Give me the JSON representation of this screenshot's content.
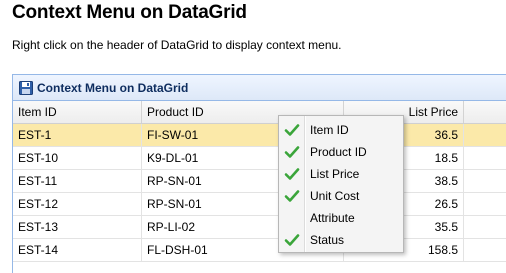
{
  "page": {
    "title": "Context Menu on DataGrid",
    "description": "Right click on the header of DataGrid to display context menu."
  },
  "grid": {
    "panel_title": "Context Menu on DataGrid",
    "panel_icon": "save-icon",
    "columns": [
      "Item ID",
      "Product ID",
      "List Price",
      ""
    ],
    "rows": [
      [
        "EST-1",
        "FI-SW-01",
        "36.5",
        ""
      ],
      [
        "EST-10",
        "K9-DL-01",
        "18.5",
        ""
      ],
      [
        "EST-11",
        "RP-SN-01",
        "38.5",
        ""
      ],
      [
        "EST-12",
        "RP-SN-01",
        "26.5",
        ""
      ],
      [
        "EST-13",
        "RP-LI-02",
        "35.5",
        ""
      ],
      [
        "EST-14",
        "FL-DSH-01",
        "158.5",
        ""
      ]
    ],
    "selected_row": 0
  },
  "context_menu": {
    "items": [
      {
        "label": "Item ID",
        "checked": true
      },
      {
        "label": "Product ID",
        "checked": true
      },
      {
        "label": "List Price",
        "checked": true
      },
      {
        "label": "Unit Cost",
        "checked": true
      },
      {
        "label": "Attribute",
        "checked": false
      },
      {
        "label": "Status",
        "checked": true
      }
    ],
    "check_icon": "checkmark-icon"
  },
  "colors": {
    "selected_row": "#fbe9a9",
    "header_border": "#95b8e7",
    "check": "#3aa53a"
  }
}
